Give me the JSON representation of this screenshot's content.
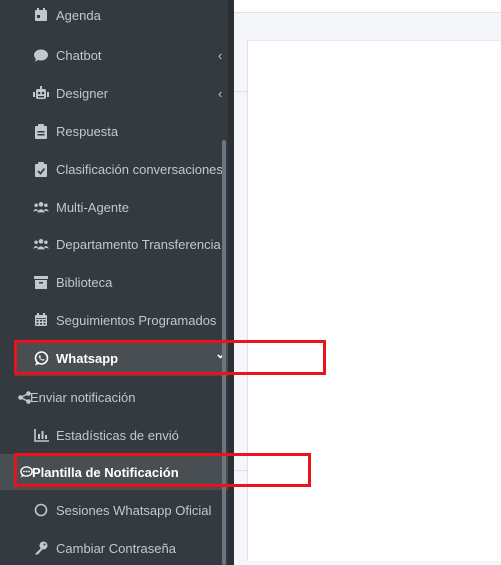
{
  "sidebar": {
    "items": [
      {
        "label": "Agenda",
        "icon": "calendar-icon"
      },
      {
        "label": "Chatbot",
        "icon": "comment-icon",
        "chevron": "‹"
      },
      {
        "label": "Designer",
        "icon": "robot-icon",
        "chevron": "‹"
      },
      {
        "label": "Respuesta",
        "icon": "clipboard-icon"
      },
      {
        "label": "Clasificación conversaciones",
        "icon": "clipboard-check-icon"
      },
      {
        "label": "Multi-Agente",
        "icon": "users-icon"
      },
      {
        "label": "Departamento Transferencia",
        "icon": "users-icon"
      },
      {
        "label": "Biblioteca",
        "icon": "archive-icon"
      },
      {
        "label": "Seguimientos Programados",
        "icon": "calendar-grid-icon"
      },
      {
        "label": "Whatsapp",
        "icon": "whatsapp-icon",
        "chevron": "⌄"
      },
      {
        "label": "Enviar notificación",
        "icon": "share-icon"
      },
      {
        "label": "Estadísticas de envió",
        "icon": "chart-bar-icon"
      },
      {
        "label": "Plantilla de Notificación",
        "icon": "comment-dots-icon"
      },
      {
        "label": "Sesiones Whatsapp Oficial",
        "icon": "circle-icon"
      },
      {
        "label": "Cambiar Contraseña",
        "icon": "key-icon"
      }
    ]
  },
  "colors": {
    "sidebar_bg": "#343a40",
    "sidebar_text": "#c2c7d0",
    "highlight": "#e8131d"
  }
}
